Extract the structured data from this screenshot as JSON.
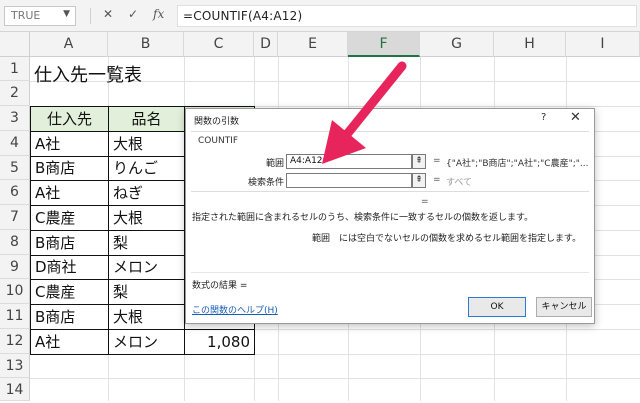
{
  "formula_bar": {
    "name_box": "TRUE",
    "cancel_icon": "✕",
    "enter_icon": "✓",
    "fx_icon": "fx",
    "formula": "=COUNTIF(A4:A12)"
  },
  "columns": [
    "A",
    "B",
    "C",
    "D",
    "E",
    "F",
    "G",
    "H",
    "I"
  ],
  "rows": [
    "1",
    "2",
    "3",
    "4",
    "5",
    "6",
    "7",
    "8",
    "9",
    "10",
    "11",
    "12",
    "13",
    "14"
  ],
  "sheet": {
    "title": "仕入先一覧表",
    "headers": {
      "supplier": "仕入先",
      "item": "品名"
    },
    "data": [
      {
        "supplier": "A社",
        "item": "大根"
      },
      {
        "supplier": "B商店",
        "item": "りんご"
      },
      {
        "supplier": "A社",
        "item": "ねぎ"
      },
      {
        "supplier": "C農産",
        "item": "大根"
      },
      {
        "supplier": "B商店",
        "item": "梨"
      },
      {
        "supplier": "D商社",
        "item": "メロン"
      },
      {
        "supplier": "C農産",
        "item": "梨"
      },
      {
        "supplier": "B商店",
        "item": "大根"
      },
      {
        "supplier": "A社",
        "item": "メロン"
      }
    ],
    "last_price": "1,080"
  },
  "dialog": {
    "title": "関数の引数",
    "help": "?",
    "close": "✕",
    "function_name": "COUNTIF",
    "arg1": {
      "label": "範囲",
      "value": "A4:A12",
      "eq": "=",
      "result": "{\"A社\";\"B商店\";\"A社\";\"C農産\";\"..."
    },
    "arg2": {
      "label": "検索条件",
      "value": "",
      "eq": "=",
      "result": "すべて"
    },
    "result_eq": "=",
    "description": "指定された範囲に含まれるセルのうち、検索条件に一致するセルの個数を返します。",
    "arg_description": "範囲　には空白でないセルの個数を求めるセル範囲を指定します。",
    "formula_result": "数式の結果 =",
    "help_link": "この関数のヘルプ(H)",
    "ok": "OK",
    "cancel": "キャンセル"
  },
  "colors": {
    "accent": "#e8245d",
    "header_green": "#e2efda",
    "selected_col": "#217346"
  }
}
